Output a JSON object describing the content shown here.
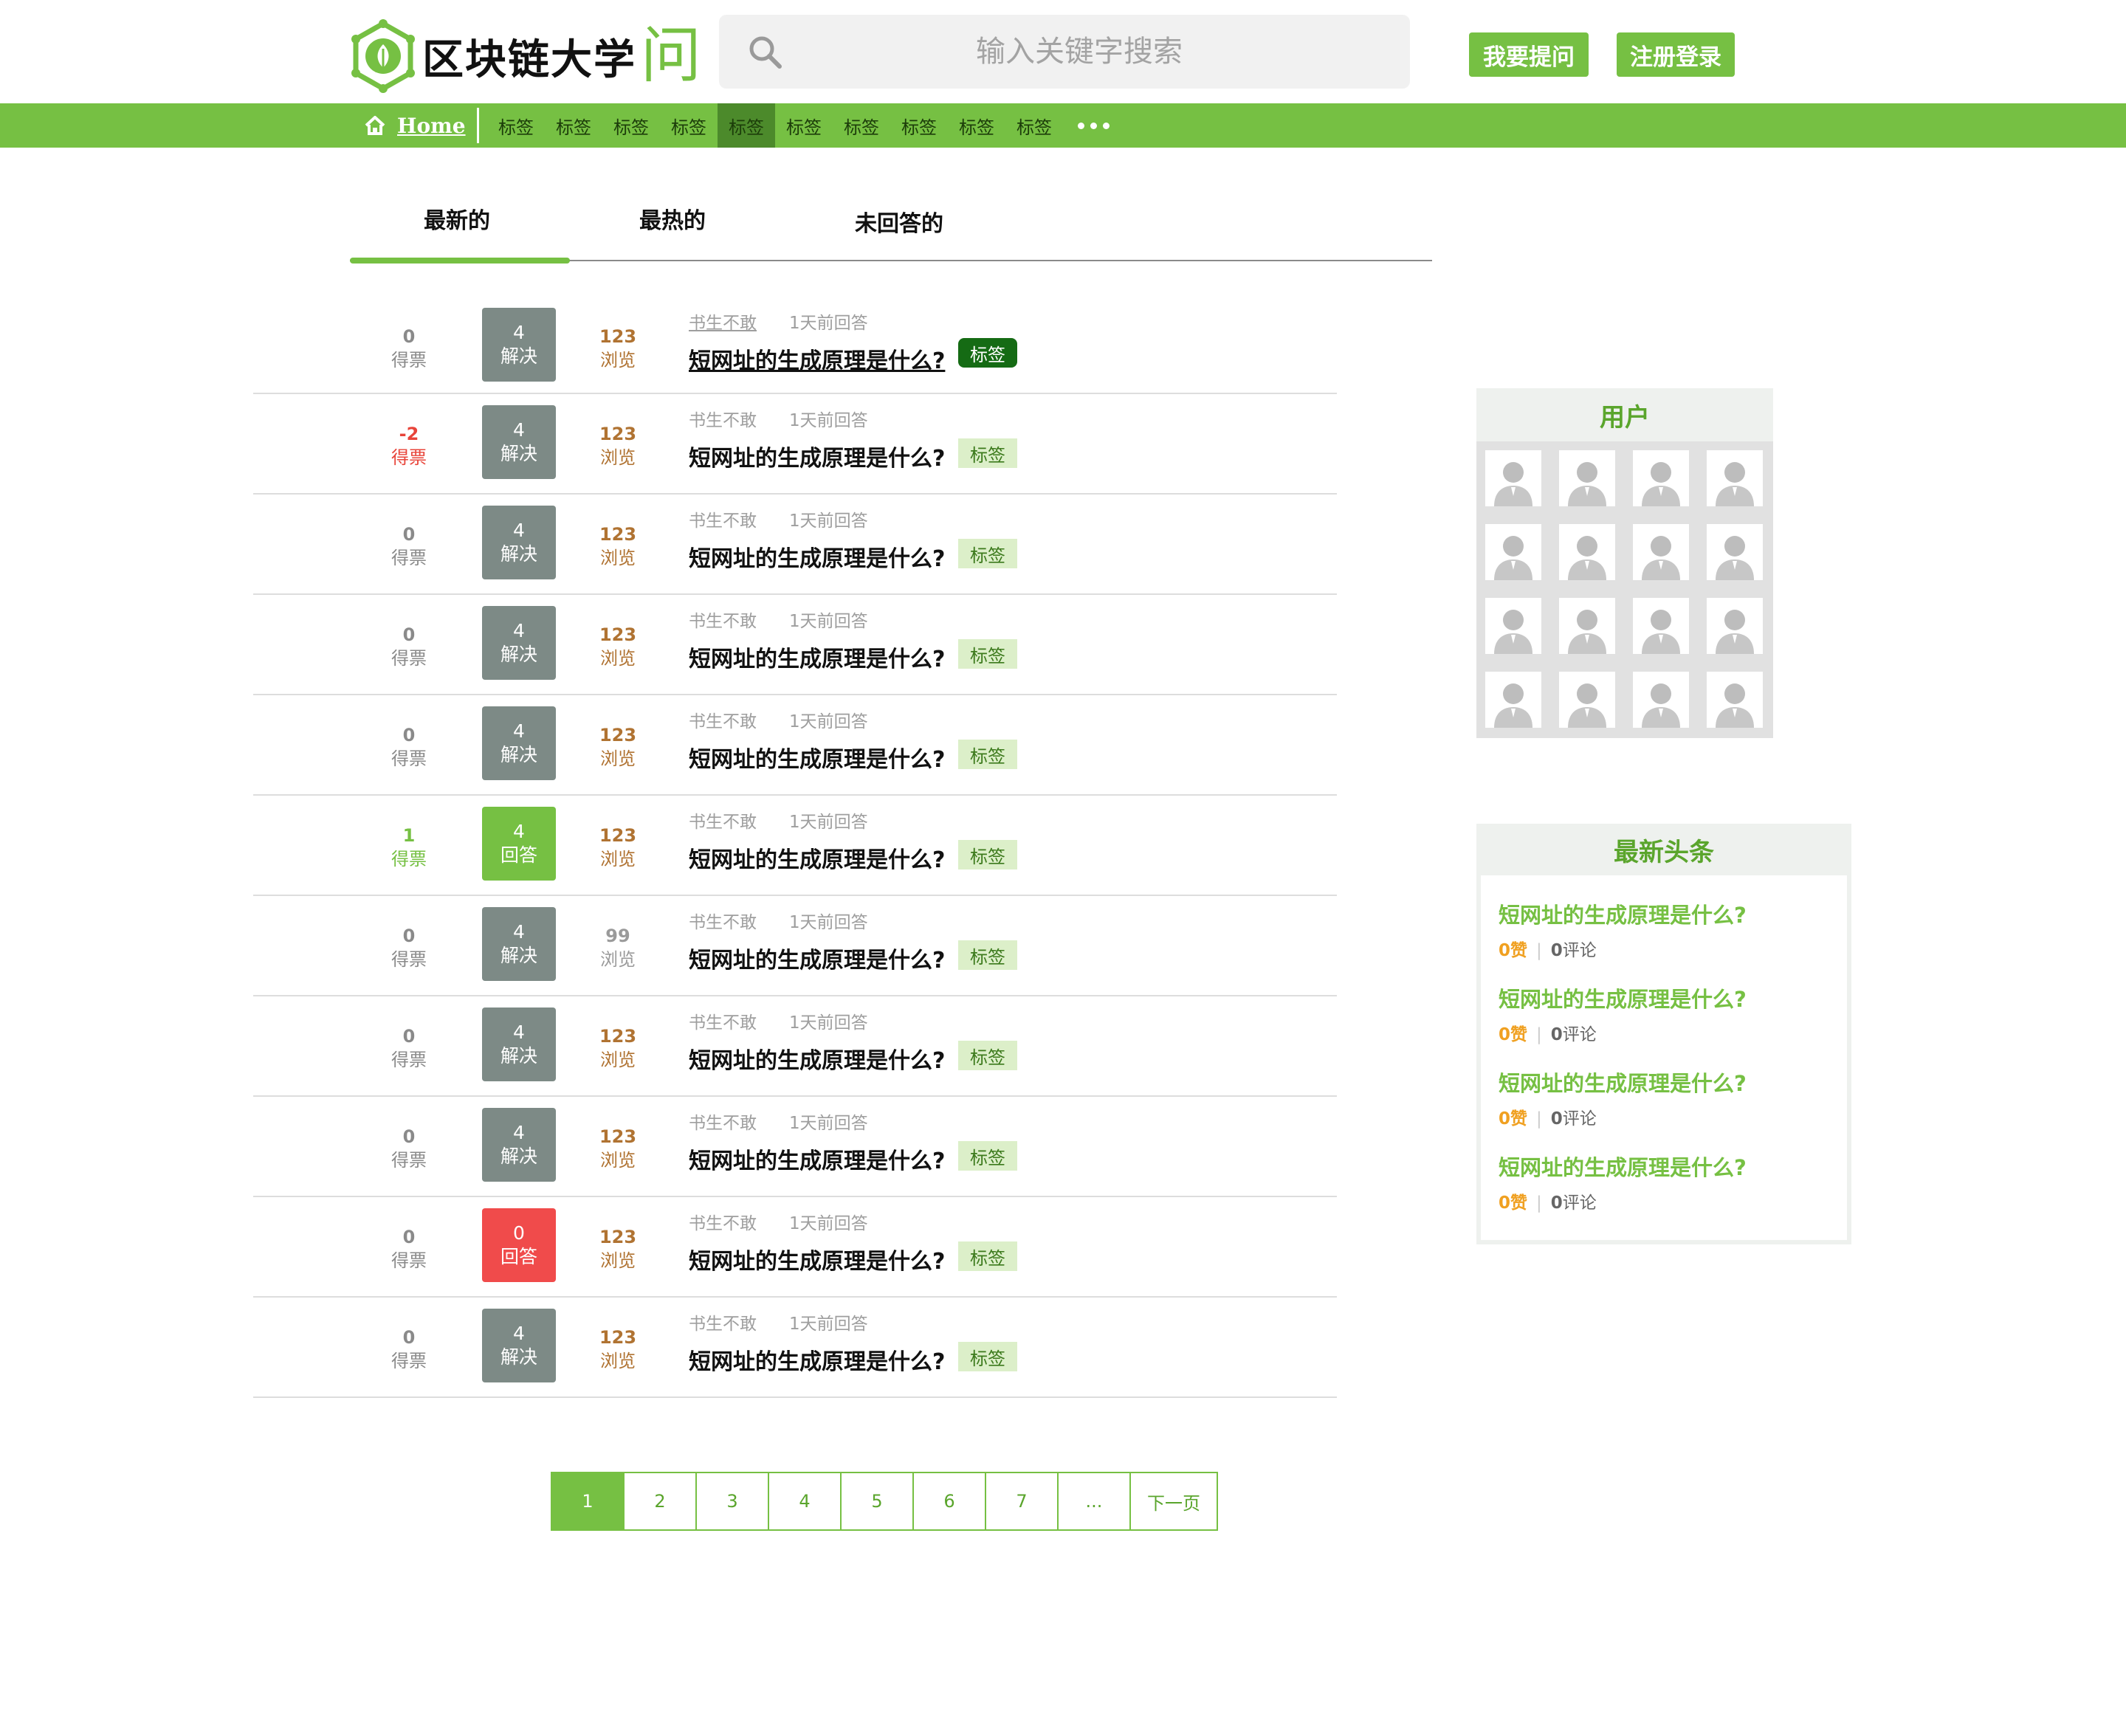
{
  "header": {
    "logo_text": "区块链大学",
    "logo_accent": "问",
    "search_placeholder": "输入关键字搜索",
    "ask_button": "我要提问",
    "login_button": "注册登录"
  },
  "nav": {
    "home": "Home",
    "tags": [
      "标签",
      "标签",
      "标签",
      "标签",
      "标签",
      "标签",
      "标签",
      "标签",
      "标签",
      "标签"
    ],
    "active_index": 4
  },
  "tabs": [
    "最新的",
    "最热的",
    "未回答的"
  ],
  "questions": [
    {
      "votes": "0",
      "votes_label": "得票",
      "answers": "4",
      "answers_label": "解决",
      "views": "123",
      "views_label": "浏览",
      "author": "书生不敢",
      "time": "1天前回答",
      "title": "短网址的生成原理是什么?",
      "tag": "标签"
    },
    {
      "votes": "-2",
      "votes_label": "得票",
      "answers": "4",
      "answers_label": "解决",
      "views": "123",
      "views_label": "浏览",
      "author": "书生不敢",
      "time": "1天前回答",
      "title": "短网址的生成原理是什么?",
      "tag": "标签"
    },
    {
      "votes": "0",
      "votes_label": "得票",
      "answers": "4",
      "answers_label": "解决",
      "views": "123",
      "views_label": "浏览",
      "author": "书生不敢",
      "time": "1天前回答",
      "title": "短网址的生成原理是什么?",
      "tag": "标签"
    },
    {
      "votes": "0",
      "votes_label": "得票",
      "answers": "4",
      "answers_label": "解决",
      "views": "123",
      "views_label": "浏览",
      "author": "书生不敢",
      "time": "1天前回答",
      "title": "短网址的生成原理是什么?",
      "tag": "标签"
    },
    {
      "votes": "0",
      "votes_label": "得票",
      "answers": "4",
      "answers_label": "解决",
      "views": "123",
      "views_label": "浏览",
      "author": "书生不敢",
      "time": "1天前回答",
      "title": "短网址的生成原理是什么?",
      "tag": "标签"
    },
    {
      "votes": "1",
      "votes_label": "得票",
      "answers": "4",
      "answers_label": "回答",
      "views": "123",
      "views_label": "浏览",
      "author": "书生不敢",
      "time": "1天前回答",
      "title": "短网址的生成原理是什么?",
      "tag": "标签"
    },
    {
      "votes": "0",
      "votes_label": "得票",
      "answers": "4",
      "answers_label": "解决",
      "views": "99",
      "views_label": "浏览",
      "author": "书生不敢",
      "time": "1天前回答",
      "title": "短网址的生成原理是什么?",
      "tag": "标签"
    },
    {
      "votes": "0",
      "votes_label": "得票",
      "answers": "4",
      "answers_label": "解决",
      "views": "123",
      "views_label": "浏览",
      "author": "书生不敢",
      "time": "1天前回答",
      "title": "短网址的生成原理是什么?",
      "tag": "标签"
    },
    {
      "votes": "0",
      "votes_label": "得票",
      "answers": "4",
      "answers_label": "解决",
      "views": "123",
      "views_label": "浏览",
      "author": "书生不敢",
      "time": "1天前回答",
      "title": "短网址的生成原理是什么?",
      "tag": "标签"
    },
    {
      "votes": "0",
      "votes_label": "得票",
      "answers": "0",
      "answers_label": "回答",
      "views": "123",
      "views_label": "浏览",
      "author": "书生不敢",
      "time": "1天前回答",
      "title": "短网址的生成原理是什么?",
      "tag": "标签"
    },
    {
      "votes": "0",
      "votes_label": "得票",
      "answers": "4",
      "answers_label": "解决",
      "views": "123",
      "views_label": "浏览",
      "author": "书生不敢",
      "time": "1天前回答",
      "title": "短网址的生成原理是什么?",
      "tag": "标签"
    }
  ],
  "pagination": [
    "1",
    "2",
    "3",
    "4",
    "5",
    "6",
    "7",
    "...",
    "下一页"
  ],
  "users_panel": {
    "title": "用户"
  },
  "news_panel": {
    "title": "最新头条",
    "items": [
      {
        "title": "短网址的生成原理是什么?",
        "likes": "0赞",
        "comments_num": "0",
        "comments_label": "评论"
      },
      {
        "title": "短网址的生成原理是什么?",
        "likes": "0赞",
        "comments_num": "0",
        "comments_label": "评论"
      },
      {
        "title": "短网址的生成原理是什么?",
        "likes": "0赞",
        "comments_num": "0",
        "comments_label": "评论"
      },
      {
        "title": "短网址的生成原理是什么?",
        "likes": "0赞",
        "comments_num": "0",
        "comments_label": "评论"
      }
    ]
  },
  "colors": {
    "brand_green": "#76c043",
    "nav_active": "#4c8a2b",
    "answered_gray": "#7d8a86",
    "unanswered_red": "#f04b4b",
    "views_brown": "#b07332",
    "likes_orange": "#f0a020"
  },
  "icons": [
    "logo-icon",
    "search-icon",
    "home-icon",
    "avatar-icon"
  ]
}
